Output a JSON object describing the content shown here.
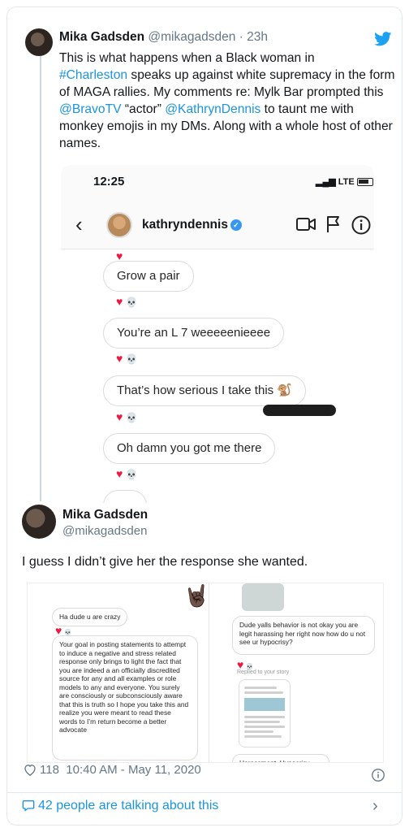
{
  "tweet1": {
    "name": "Mika Gadsden",
    "handle": "@mikagadsden",
    "separator": "·",
    "time": "23h",
    "text_1": "This is what happens when a Black woman in",
    "hashtag": "#Charleston",
    "text_2": " speaks up against white supremacy in the form of MAGA rallies. My comments re: Mylk Bar prompted this ",
    "mention_1": "@BravoTV",
    "text_3": " “actor” ",
    "mention_2": "@KathrynDennis",
    "text_4": " to taunt me with monkey emojis in my DMs. Along with a whole host of other names."
  },
  "phone": {
    "clock": "12:25",
    "network": "LTE",
    "username": "kathryndennis",
    "back_glyph": "‹",
    "messages": [
      "Grow a pair",
      "You’re an L 7 weeeeenieeee",
      "That’s how serious I take this 🐒",
      "Oh damn you got me there"
    ],
    "reaction": "💀"
  },
  "tweet2": {
    "name": "Mika Gadsden",
    "handle": "@mikagadsden",
    "text": "I guess I didn’t give her the response she wanted."
  },
  "media2": {
    "hand": "🤘🏿",
    "left_bubble_1": "Ha dude u are crazy",
    "left_bubble_2": "Your goal in posting statements to attempt to induce a negative and stress related response only brings to light the fact that you are indeed a an officially discredited source for any and all examples or role models to any and everyone. You surely are consciously or subconsciously aware that this is truth so I hope you take this and realize you were meant to read these words to I’m return become a better advocate",
    "right_bubble_1": "Dude yalls behavior is not okay you are legit harassing her right now how do u not see ur hypocrisy?",
    "replied_note": "Replied to your story",
    "cut_text": "Harassment. Hypocrisy."
  },
  "footer": {
    "likes": "118",
    "timestamp": "10:40 AM - May 11, 2020",
    "talking": "42 people are talking about this",
    "chevron": "›"
  },
  "colors": {
    "link": "#1b95e0",
    "muted": "#657786",
    "border": "#e1e8ed",
    "heart": "#ed1941"
  }
}
